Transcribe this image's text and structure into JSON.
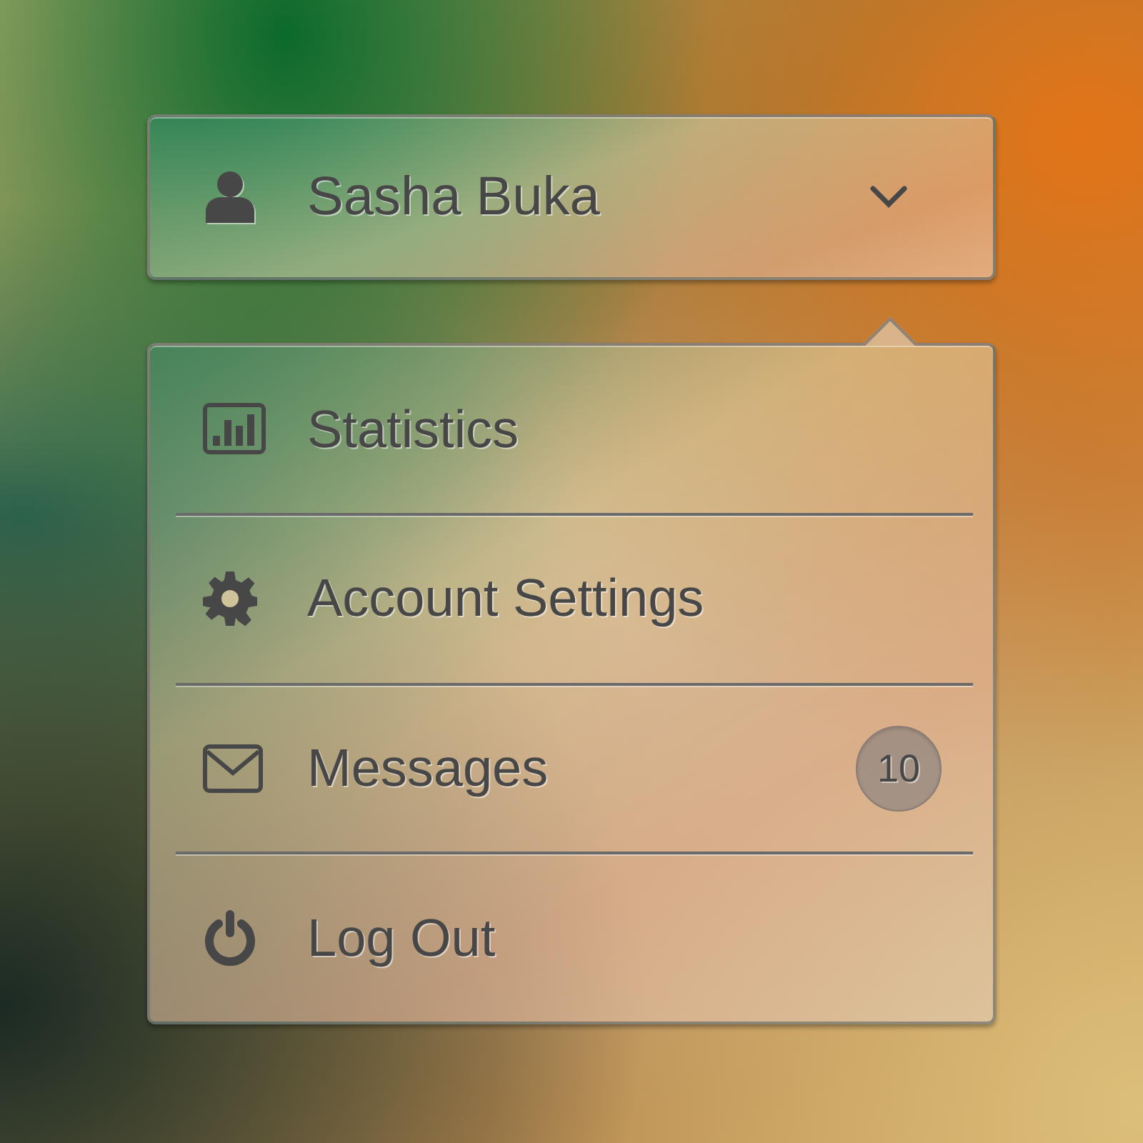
{
  "user_menu": {
    "name": "Sasha Buka",
    "expanded": true
  },
  "menu": {
    "items": [
      {
        "label": "Statistics"
      },
      {
        "label": "Account Settings"
      },
      {
        "label": "Messages",
        "badge": "10"
      },
      {
        "label": "Log Out"
      }
    ]
  }
}
